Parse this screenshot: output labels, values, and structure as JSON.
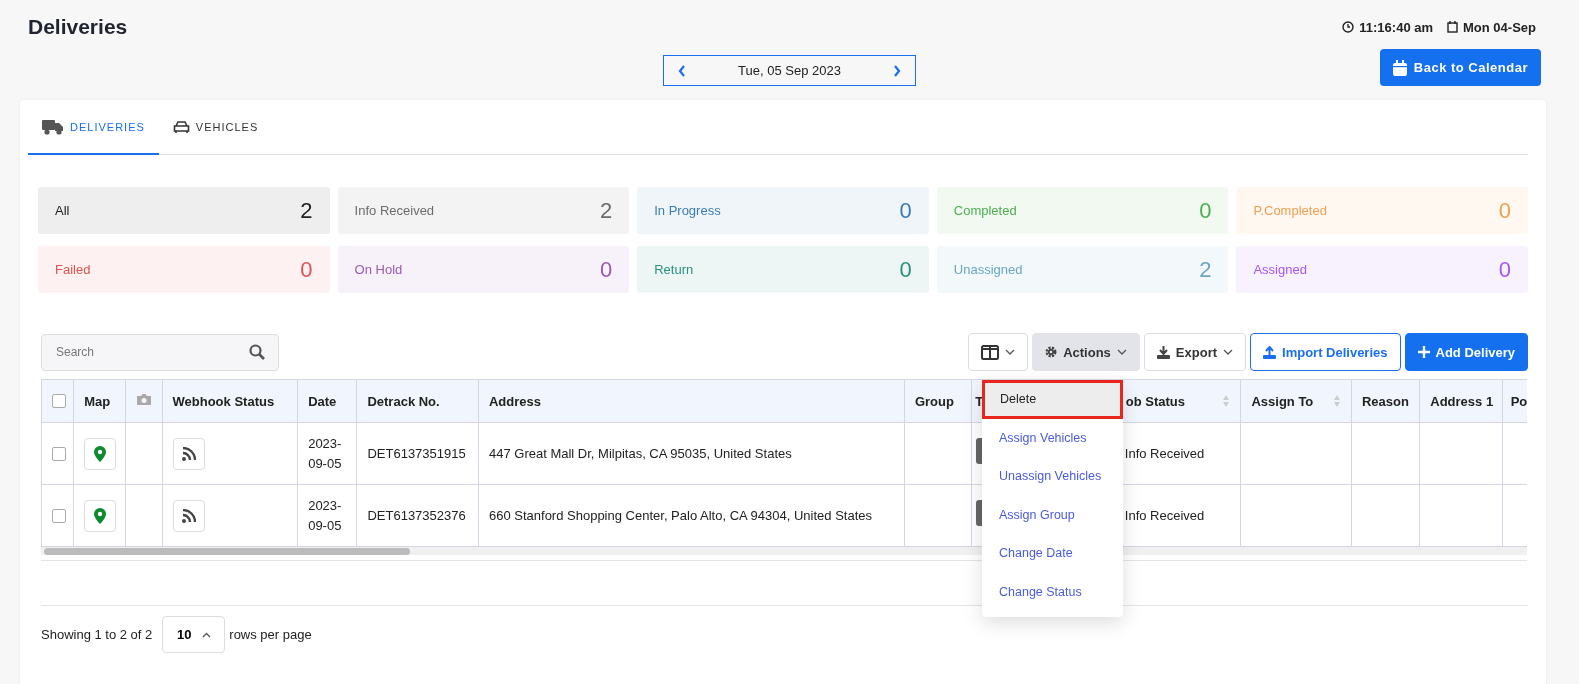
{
  "page_title": "Deliveries",
  "clock": {
    "time": "11:16:40 am",
    "date": "Mon 04-Sep"
  },
  "date_nav": {
    "label": "Tue, 05 Sep 2023"
  },
  "back_button": "Back to Calendar",
  "tabs": [
    {
      "label": "DELIVERIES",
      "kind": "truck",
      "selected": true
    },
    {
      "label": "VEHICLES",
      "kind": "car",
      "selected": false
    }
  ],
  "status_cards": [
    {
      "label": "All",
      "count": "2",
      "color": "#222222"
    },
    {
      "label": "Info Received",
      "count": "2",
      "color": "#6b6b6b"
    },
    {
      "label": "In Progress",
      "count": "0",
      "color": "#3a7cb5"
    },
    {
      "label": "Completed",
      "count": "0",
      "color": "#4caf50"
    },
    {
      "label": "P.Completed",
      "count": "0",
      "color": "#f0a050"
    },
    {
      "label": "Failed",
      "count": "0",
      "color": "#e05050"
    },
    {
      "label": "On Hold",
      "count": "0",
      "color": "#9b59b6"
    },
    {
      "label": "Return",
      "count": "0",
      "color": "#2a9080"
    },
    {
      "label": "Unassigned",
      "count": "2",
      "color": "#6aa6c0"
    },
    {
      "label": "Assigned",
      "count": "0",
      "color": "#a855f7"
    }
  ],
  "search": {
    "placeholder": "Search"
  },
  "toolbar": {
    "actions": "Actions",
    "export": "Export",
    "import": "Import Deliveries",
    "add": "Add Delivery"
  },
  "table": {
    "columns": [
      {
        "kind": "checkbox",
        "checked": false
      },
      {
        "kind": "text",
        "label": "Map"
      },
      {
        "kind": "camera"
      },
      {
        "kind": "text",
        "label": "Webhook Status"
      },
      {
        "kind": "text",
        "label": "Date"
      },
      {
        "kind": "text",
        "label": "Detrack No."
      },
      {
        "kind": "text",
        "label": "Address"
      },
      {
        "kind": "text",
        "label": "Group"
      },
      {
        "kind": "text",
        "label": "T"
      },
      {
        "kind": "text",
        "label": "ob Status",
        "sortable": true
      },
      {
        "kind": "text",
        "label": "Assign To",
        "sortable": true
      },
      {
        "kind": "text",
        "label": "Reason"
      },
      {
        "kind": "text",
        "label": "Address 1"
      },
      {
        "kind": "text",
        "label": "Po"
      }
    ],
    "rows": [
      {
        "checked": false,
        "date": "2023-09-05",
        "detrack_no": "DET6137351915",
        "address": "447 Great Mall Dr, Milpitas, CA 95035, United States",
        "job_status": "Info Received"
      },
      {
        "checked": false,
        "date": "2023-09-05",
        "detrack_no": "DET6137352376",
        "address": "660 Stanford Shopping Center, Palo Alto, CA 94304, United States",
        "job_status": "Info Received"
      }
    ]
  },
  "actions_menu": {
    "items": [
      {
        "label": "Delete",
        "selected": true
      },
      {
        "label": "Assign Vehicles",
        "selected": false
      },
      {
        "label": "Unassign Vehicles",
        "selected": false
      },
      {
        "label": "Assign Group",
        "selected": false
      },
      {
        "label": "Change Date",
        "selected": false
      },
      {
        "label": "Change Status",
        "selected": false
      }
    ]
  },
  "pagination": {
    "summary": "Showing 1 to 2 of 2",
    "page_size": "10",
    "suffix": "rows per page"
  }
}
